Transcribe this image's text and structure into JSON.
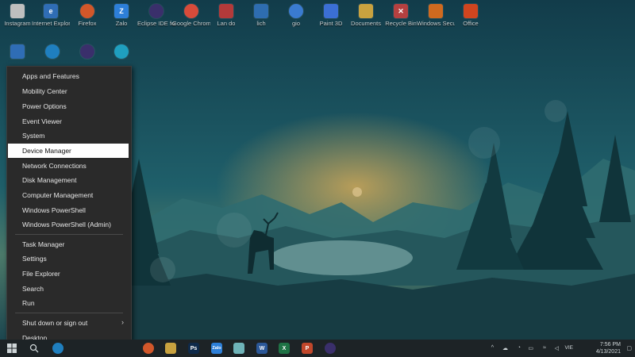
{
  "desktop": {
    "icons": [
      {
        "label": "Instagram",
        "icon": "instagram-icon",
        "color": "#bfbfbf"
      },
      {
        "label": "Internet Explorer",
        "icon": "internet-explorer-icon",
        "color": "#2f6db5"
      },
      {
        "label": "Firefox",
        "icon": "firefox-icon",
        "color": "#d2572a"
      },
      {
        "label": "Zalo",
        "icon": "zalo-icon",
        "color": "#2d7fd8"
      },
      {
        "label": "Eclipse IDE for Java and...",
        "icon": "eclipse-icon",
        "color": "#3a2f6b"
      },
      {
        "label": "Google Chrome",
        "icon": "chrome-icon",
        "color": "#d84b3a"
      },
      {
        "label": "Lan do",
        "icon": "shortcut-icon",
        "color": "#b33a3a"
      },
      {
        "label": "lich",
        "icon": "calendar-icon",
        "color": "#2e6db0"
      },
      {
        "label": "gio",
        "icon": "clock-icon",
        "color": "#3a7bd0"
      },
      {
        "label": "Paint 3D",
        "icon": "paint-3d-icon",
        "color": "#3b6fd4"
      },
      {
        "label": "Documents",
        "icon": "folder-icon",
        "color": "#c9a23f"
      },
      {
        "label": "Recycle Bin",
        "icon": "recycle-bin-icon",
        "color": "#b54040"
      },
      {
        "label": "Windows Security",
        "icon": "shield-icon",
        "color": "#d06a1f"
      },
      {
        "label": "Office",
        "icon": "office-icon",
        "color": "#d0451f"
      }
    ],
    "row2_icons": [
      {
        "label": "",
        "icon": "shortcut-icon",
        "color": "#2f6db5"
      },
      {
        "label": "",
        "icon": "edge-icon",
        "color": "#1f7fbf"
      },
      {
        "label": "",
        "icon": "eclipse-icon",
        "color": "#3a2f6b"
      },
      {
        "label": "",
        "icon": "edge-icon",
        "color": "#1f9fbf"
      }
    ]
  },
  "menu": {
    "items": [
      {
        "label": "Apps and Features"
      },
      {
        "label": "Mobility Center"
      },
      {
        "label": "Power Options"
      },
      {
        "label": "Event Viewer"
      },
      {
        "label": "System"
      },
      {
        "label": "Device Manager",
        "selected": true
      },
      {
        "label": "Network Connections"
      },
      {
        "label": "Disk Management"
      },
      {
        "label": "Computer Management"
      },
      {
        "label": "Windows PowerShell"
      },
      {
        "label": "Windows PowerShell (Admin)"
      },
      {
        "label": "Task Manager"
      },
      {
        "label": "Settings"
      },
      {
        "label": "File Explorer"
      },
      {
        "label": "Search"
      },
      {
        "label": "Run"
      },
      {
        "label": "Shut down or sign out",
        "submenu": true
      },
      {
        "label": "Desktop"
      }
    ]
  },
  "taskbar": {
    "apps": [
      {
        "icon": "start-icon",
        "color": "#3a4a50"
      },
      {
        "icon": "search-icon",
        "color": "#3a4a50"
      },
      {
        "icon": "edge-icon",
        "color": "#1f7fbf"
      },
      {
        "icon": "firefox-icon",
        "color": "#d2572a"
      },
      {
        "icon": "app-icon",
        "color": "#c9a23f"
      },
      {
        "icon": "photoshop-icon",
        "color": "#0f2a4a",
        "text": "Ps"
      },
      {
        "icon": "zalo-icon",
        "color": "#2d7fd8",
        "text": "Zalo"
      },
      {
        "icon": "app-icon",
        "color": "#6fb3b8"
      },
      {
        "icon": "word-icon",
        "color": "#2b5797",
        "text": "W"
      },
      {
        "icon": "excel-icon",
        "color": "#1f7245",
        "text": "X"
      },
      {
        "icon": "powerpoint-icon",
        "color": "#c1472b",
        "text": "P"
      },
      {
        "icon": "eclipse-icon",
        "color": "#3a2f6b"
      }
    ],
    "language": "VIE",
    "time": "7:56 PM",
    "date": "4/13/2021"
  }
}
